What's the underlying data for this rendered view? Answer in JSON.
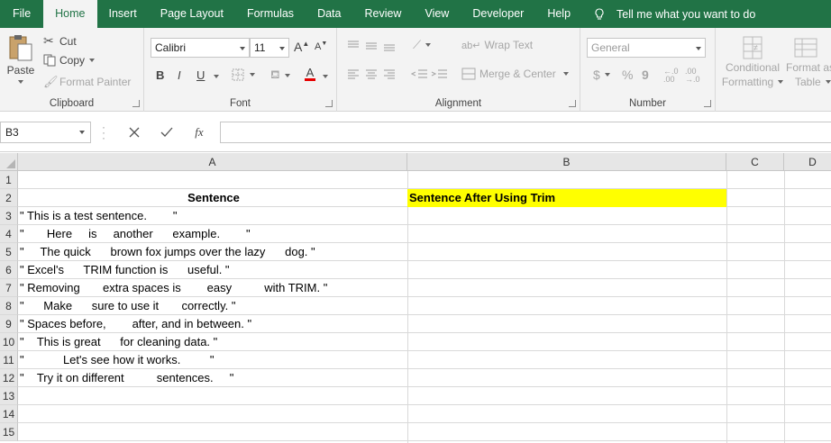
{
  "tabs": [
    "File",
    "Home",
    "Insert",
    "Page Layout",
    "Formulas",
    "Data",
    "Review",
    "View",
    "Developer",
    "Help"
  ],
  "active_tab": "Home",
  "tell_me": "Tell me what you want to do",
  "clipboard": {
    "paste": "Paste",
    "cut": "Cut",
    "copy": "Copy",
    "format_painter": "Format Painter",
    "label": "Clipboard"
  },
  "font": {
    "name": "Calibri",
    "size": "11",
    "bold": "B",
    "italic": "I",
    "underline": "U",
    "grow": "A",
    "shrink": "A",
    "font_color_letter": "A",
    "label": "Font"
  },
  "alignment": {
    "wrap_text": "Wrap Text",
    "merge_center": "Merge & Center",
    "label": "Alignment"
  },
  "number": {
    "format": "General",
    "currency": "$",
    "percent": "%",
    "comma": "9",
    "label": "Number"
  },
  "styles": {
    "conditional": [
      "Conditional",
      "Formatting"
    ],
    "format_as": [
      "Format as",
      "Table"
    ]
  },
  "formula_bar": {
    "name_box": "B3",
    "formula": ""
  },
  "columns": [
    "A",
    "B",
    "C",
    "D"
  ],
  "rows": [
    "1",
    "2",
    "3",
    "4",
    "5",
    "6",
    "7",
    "8",
    "9",
    "10",
    "11",
    "12",
    "13",
    "14",
    "15"
  ],
  "cells": {
    "A2": "Sentence",
    "B2": "Sentence After Using Trim",
    "A3": "\" This is a test sentence.        \"",
    "A4": "\"       Here     is     another      example.        \"",
    "A5": "\"     The quick      brown fox jumps over the lazy      dog. \"",
    "A6": "\" Excel's      TRIM function is      useful. \"",
    "A7": "\" Removing       extra spaces is        easy          with TRIM. \"",
    "A8": "\"      Make      sure to use it       correctly. \"",
    "A9": "\" Spaces before,        after, and in between. \"",
    "A10": "\"    This is great      for cleaning data. \"",
    "A11": "\"            Let's see how it works.         \"",
    "A12": "\"    Try it on different          sentences.     \""
  },
  "colors": {
    "brand": "#217346",
    "highlight": "#ffff00"
  }
}
